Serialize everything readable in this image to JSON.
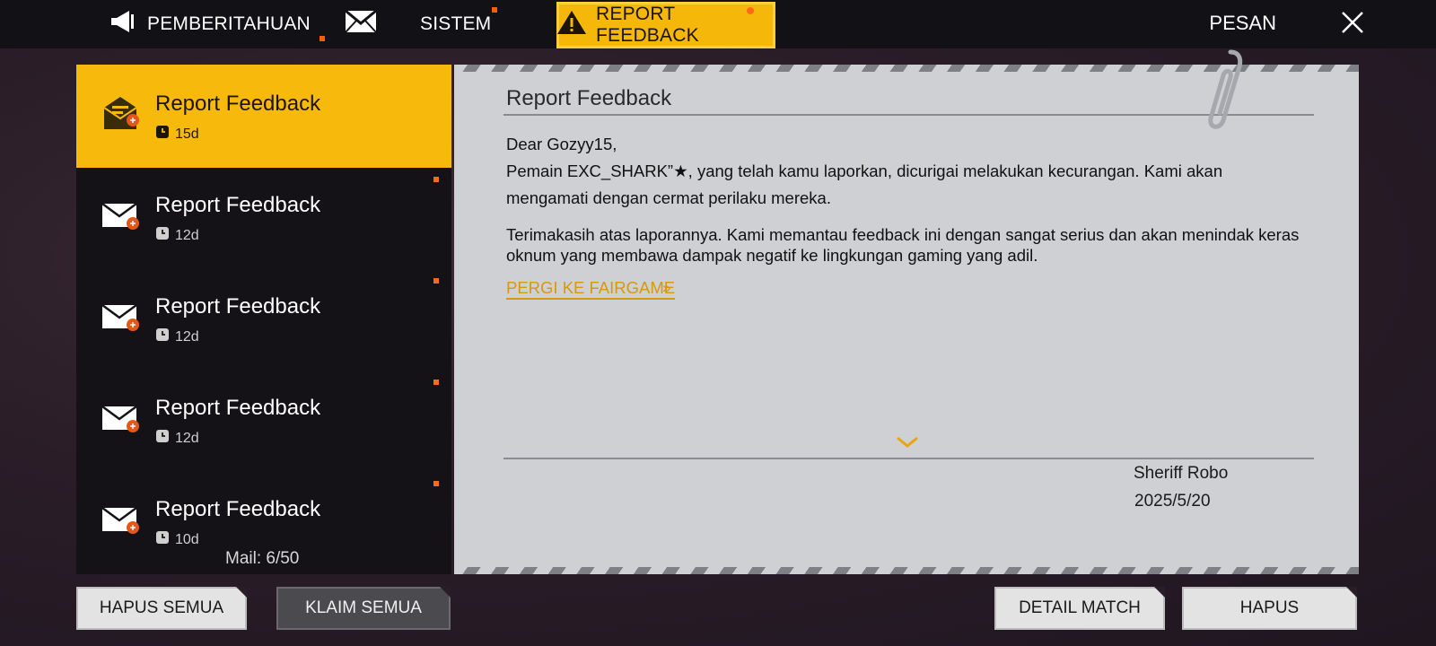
{
  "tabs": {
    "notif": "PEMBERITAHUAN",
    "system": "SISTEM",
    "report": "REPORT FEEDBACK"
  },
  "header": {
    "title": "PESAN"
  },
  "mails": [
    {
      "title": "Report Feedback",
      "time": "15d"
    },
    {
      "title": "Report Feedback",
      "time": "12d"
    },
    {
      "title": "Report Feedback",
      "time": "12d"
    },
    {
      "title": "Report Feedback",
      "time": "12d"
    },
    {
      "title": "Report Feedback",
      "time": "10d"
    }
  ],
  "mail_count": "Mail: 6/50",
  "message": {
    "title": "Report Feedback",
    "greeting": "Dear Gozyy15,",
    "para1": "Pemain EXC_SHARK”★, yang telah kamu laporkan, dicurigai melakukan kecurangan. Kami akan mengamati dengan cermat perilaku mereka.",
    "para2": "Terimakasih atas laporannya. Kami memantau feedback ini dengan sangat serius dan akan menindak keras oknum yang membawa dampak negatif ke lingkungan gaming yang adil.",
    "link": "PERGI KE FAIRGAME",
    "sender": "Sheriff Robo",
    "date": "2025/5/20"
  },
  "buttons": {
    "delete_all": "HAPUS SEMUA",
    "claim_all": "KLAIM SEMUA",
    "detail_match": "DETAIL MATCH",
    "delete": "HAPUS"
  },
  "colors": {
    "accent": "#f7b90b",
    "panel": "#cfd0d4",
    "dot": "#ff6a14"
  },
  "icons": [
    "megaphone-icon",
    "envelope-icon",
    "warning-icon",
    "close-icon",
    "mail-feedback-icon",
    "clock-icon",
    "paperclip-icon",
    "chevron-down-icon"
  ]
}
